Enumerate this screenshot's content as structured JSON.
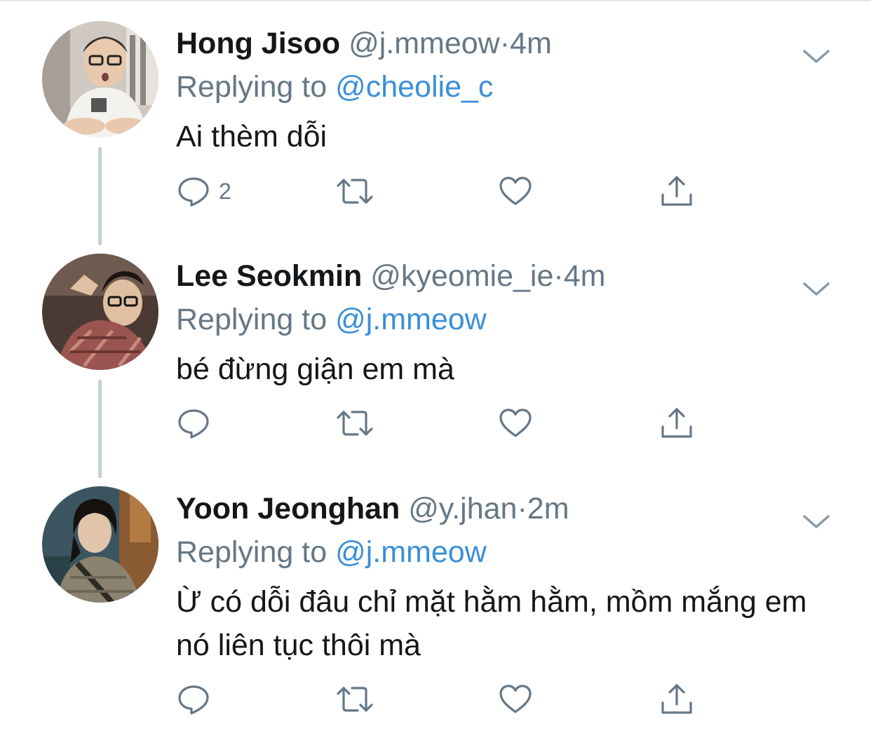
{
  "tweets": [
    {
      "name": "Hong Jisoo",
      "handle": "@j.mmeow",
      "separator": "·",
      "time": "4m",
      "replying_prefix": "Replying to ",
      "replying_to": "@cheolie_c",
      "text": "Ai thèm dỗi",
      "reply_count": "2",
      "avatar": "person-with-glasses-white-tshirt"
    },
    {
      "name": "Lee Seokmin",
      "handle": "@kyeomie_ie",
      "separator": "·",
      "time": "4m",
      "replying_prefix": "Replying to ",
      "replying_to": "@j.mmeow",
      "text": "bé đừng giận em mà",
      "reply_count": "",
      "avatar": "person-with-glasses-plaid-shirt"
    },
    {
      "name": "Yoon Jeonghan",
      "handle": "@y.jhan",
      "separator": "·",
      "time": "2m",
      "replying_prefix": "Replying to ",
      "replying_to": "@j.mmeow",
      "text": "Ừ có dỗi đâu chỉ mặt hằm hằm, mồm mắng em nó liên tục thôi mà",
      "reply_count": "",
      "avatar": "person-dark-hair-jacket"
    }
  ],
  "icons": {
    "reply": "speech-bubble-icon",
    "retweet": "retweet-icon",
    "like": "heart-icon",
    "share": "share-icon",
    "menu": "chevron-down-icon"
  },
  "colors": {
    "text": "#14171a",
    "secondary": "#657786",
    "link": "#3a8fd8",
    "thread_line": "#c4cfd6"
  }
}
